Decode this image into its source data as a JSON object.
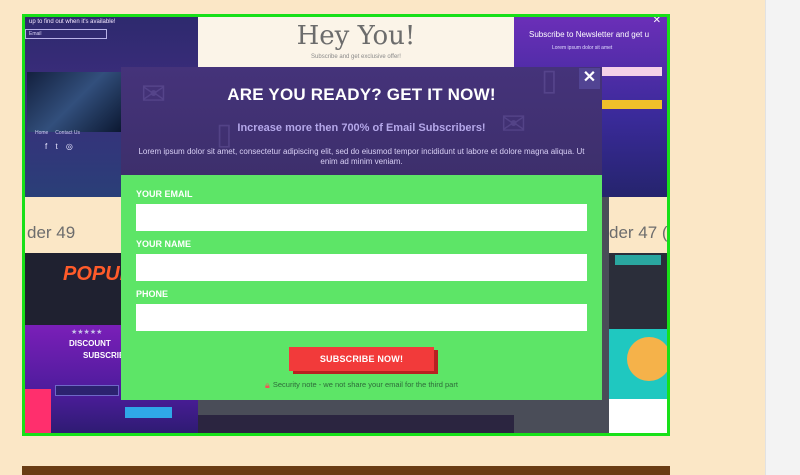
{
  "background": {
    "left_top": {
      "label": "up to find out when it's available!",
      "input_placeholder": "Email"
    },
    "center_top": {
      "heading": "Hey You!",
      "subtext": "Subscribe and get exclusive offer!"
    },
    "right_top": {
      "title": "Subscribe to Newsletter and get u",
      "subtext": "Lorem ipsum dolor sit amet"
    },
    "left_label": "der 49",
    "right_label": "der 47 (",
    "left_popup_word": "POPUP",
    "left_bottom": {
      "stars": "★★★★★",
      "title": "DISCOUNT",
      "subtitle": "SUBSCRIB"
    }
  },
  "modal": {
    "title": "ARE YOU READY? GET IT NOW!",
    "subtitle": "Increase more then 700% of Email Subscribers!",
    "description": "Lorem ipsum dolor sit amet, consectetur adipiscing elit, sed do eiusmod tempor incididunt ut labore et dolore magna aliqua. Ut enim ad minim veniam.",
    "close_symbol": "✕",
    "fields": [
      {
        "label": "YOUR EMAIL",
        "value": ""
      },
      {
        "label": "YOUR NAME",
        "value": ""
      },
      {
        "label": "PHONE",
        "value": ""
      }
    ],
    "submit_label": "SUBSCRIBE NOW!",
    "security_note": "Security note - we not share your email for the third part"
  },
  "colors": {
    "page_bg": "#fbe7c6",
    "frame_border": "#18e018",
    "modal_header": "#45337a",
    "modal_body": "#5de567",
    "button": "#f23a3a"
  },
  "icons": {
    "close": "close-icon",
    "lock": "lock-icon"
  }
}
